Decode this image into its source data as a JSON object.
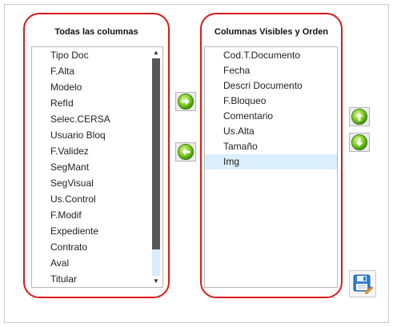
{
  "left_panel": {
    "title": "Todas las columnas",
    "items": [
      "Tipo Doc",
      "F.Alta",
      "Modelo",
      "RefId",
      "Selec.CERSA",
      "Usuario Bloq",
      "F.Validez",
      "SegMant",
      "SegVisual",
      "Us.Control",
      "F.Modif",
      "Expediente",
      "Contrato",
      "Aval",
      "Titular"
    ],
    "scroll_position": 0.0,
    "visible_fraction": 0.88
  },
  "right_panel": {
    "title": "Columnas Visibles y Orden",
    "items": [
      "Cod.T.Documento",
      "Fecha",
      "Descri Documento",
      "F.Bloqueo",
      "Comentario",
      "Us.Alta",
      "Tamaño",
      "Img"
    ],
    "selected_index": 7
  },
  "buttons": {
    "add": {
      "icon": "arrow-right-icon"
    },
    "remove": {
      "icon": "arrow-left-icon"
    },
    "move_up": {
      "icon": "arrow-up-icon"
    },
    "move_down": {
      "icon": "arrow-down-icon"
    },
    "save": {
      "icon": "save-edit-icon"
    }
  },
  "colors": {
    "group_border": "#e01818",
    "selection": "#dbeefb",
    "green_button": "#4caf10",
    "scroll_thumb": "#585854"
  }
}
